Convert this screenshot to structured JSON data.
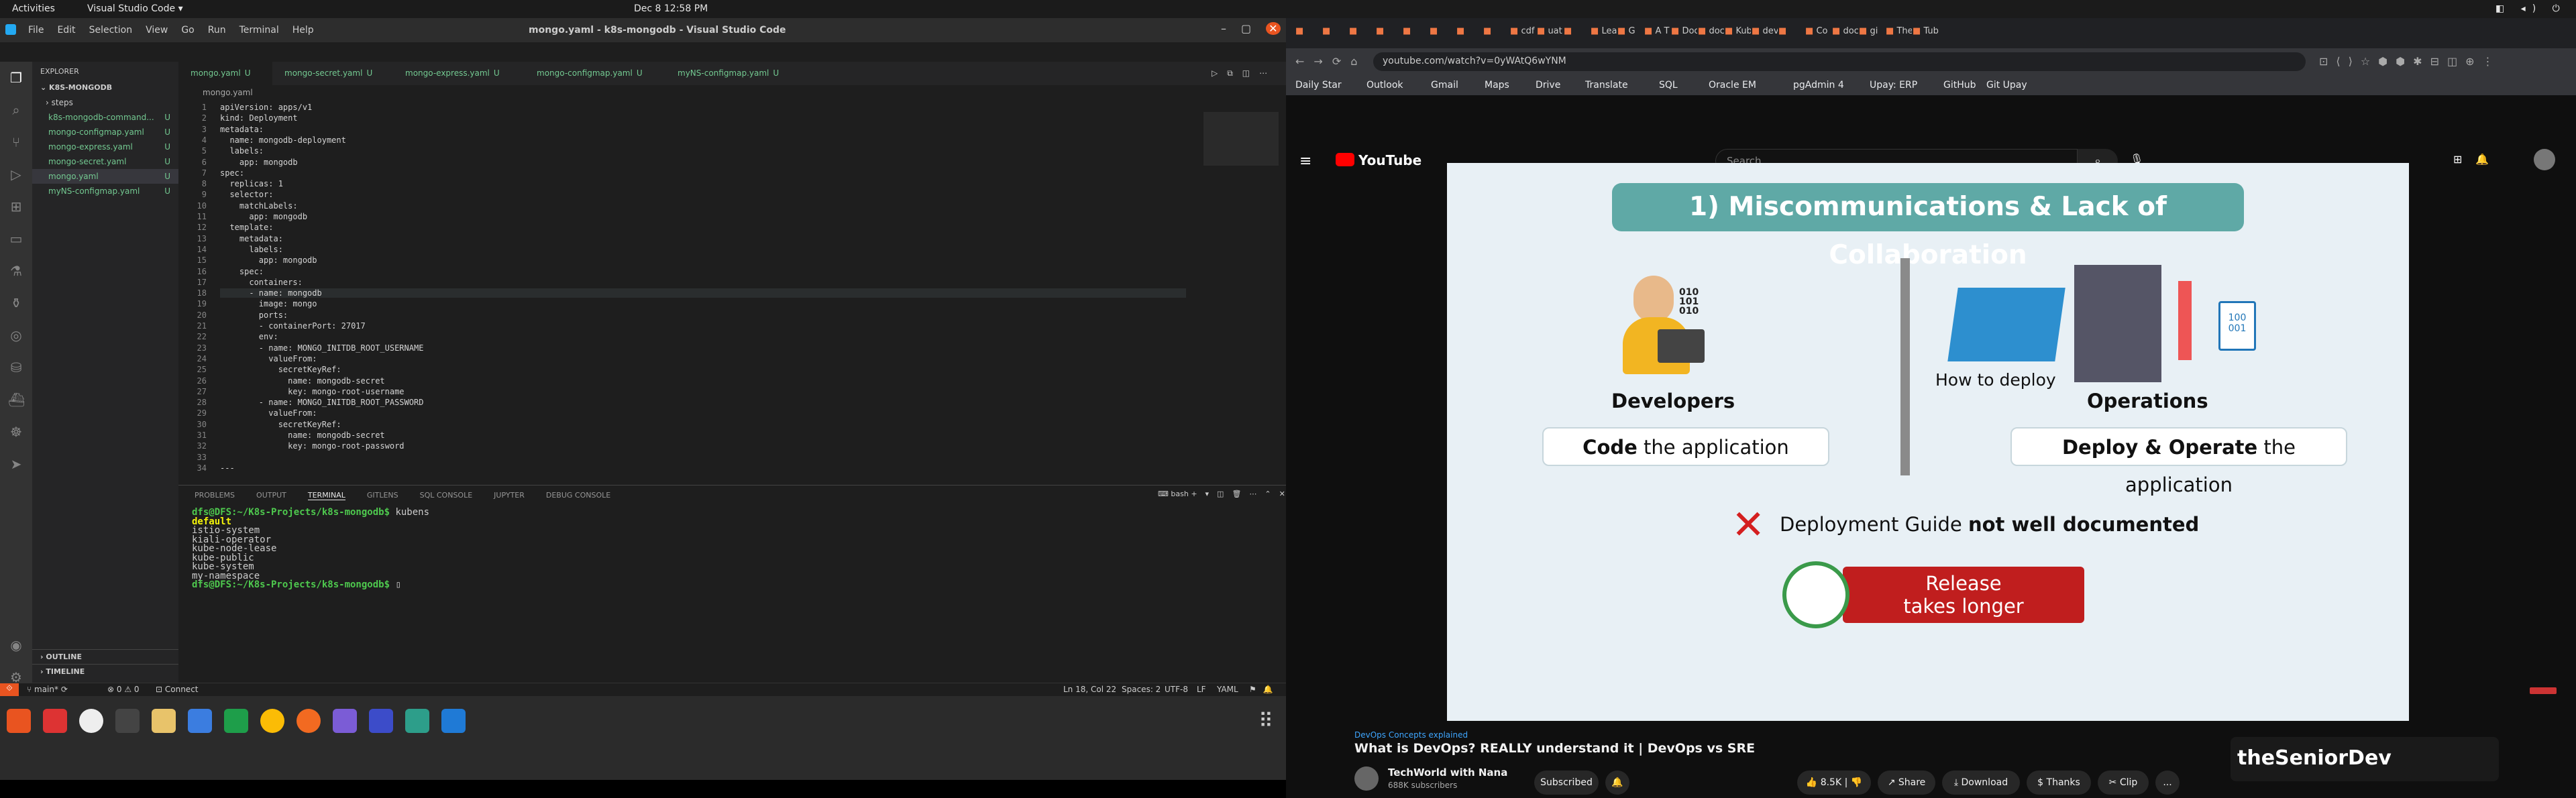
{
  "topbar": {
    "activities": "Activities",
    "app": "Visual Studio Code",
    "datetime": "Dec 8  12:58 PM"
  },
  "vscode": {
    "title": "mongo.yaml - k8s-mongodb - Visual Studio Code",
    "menu": [
      "File",
      "Edit",
      "Selection",
      "View",
      "Go",
      "Run",
      "Terminal",
      "Help"
    ],
    "explorer": {
      "header": "EXPLORER",
      "folder": "K8S-MONGODB",
      "items": [
        {
          "label": "steps",
          "badge": ""
        },
        {
          "label": "k8s-mongodb-command...",
          "badge": "U"
        },
        {
          "label": "mongo-configmap.yaml",
          "badge": "U"
        },
        {
          "label": "mongo-express.yaml",
          "badge": "U"
        },
        {
          "label": "mongo-secret.yaml",
          "badge": "U"
        },
        {
          "label": "mongo.yaml",
          "badge": "U"
        },
        {
          "label": "myNS-configmap.yaml",
          "badge": "U"
        }
      ],
      "outline": "OUTLINE",
      "timeline": "TIMELINE"
    },
    "tabs": [
      {
        "label": "mongo.yaml",
        "badge": "U"
      },
      {
        "label": "mongo-secret.yaml",
        "badge": "U"
      },
      {
        "label": "mongo-express.yaml",
        "badge": "U"
      },
      {
        "label": "mongo-configmap.yaml",
        "badge": "U"
      },
      {
        "label": "myNS-configmap.yaml",
        "badge": "U"
      }
    ],
    "breadcrumb": "mongo.yaml",
    "code": [
      [
        "1",
        "apiVersion: apps/v1"
      ],
      [
        "2",
        "kind: Deployment"
      ],
      [
        "3",
        "metadata:"
      ],
      [
        "4",
        "  name: mongodb-deployment"
      ],
      [
        "5",
        "  labels:"
      ],
      [
        "6",
        "    app: mongodb"
      ],
      [
        "7",
        "spec:"
      ],
      [
        "8",
        "  replicas: 1"
      ],
      [
        "9",
        "  selector:"
      ],
      [
        "10",
        "    matchLabels:"
      ],
      [
        "11",
        "      app: mongodb"
      ],
      [
        "12",
        "  template:"
      ],
      [
        "13",
        "    metadata:"
      ],
      [
        "14",
        "      labels:"
      ],
      [
        "15",
        "        app: mongodb"
      ],
      [
        "16",
        "    spec:"
      ],
      [
        "17",
        "      containers:"
      ],
      [
        "18",
        "      - name: mongodb"
      ],
      [
        "19",
        "        image: mongo"
      ],
      [
        "20",
        "        ports:"
      ],
      [
        "21",
        "        - containerPort: 27017"
      ],
      [
        "22",
        "        env:"
      ],
      [
        "23",
        "        - name: MONGO_INITDB_ROOT_USERNAME"
      ],
      [
        "24",
        "          valueFrom:"
      ],
      [
        "25",
        "            secretKeyRef:"
      ],
      [
        "26",
        "              name: mongodb-secret"
      ],
      [
        "27",
        "              key: mongo-root-username"
      ],
      [
        "28",
        "        - name: MONGO_INITDB_ROOT_PASSWORD"
      ],
      [
        "29",
        "          valueFrom:"
      ],
      [
        "30",
        "            secretKeyRef:"
      ],
      [
        "31",
        "              name: mongodb-secret"
      ],
      [
        "32",
        "              key: mongo-root-password"
      ],
      [
        "33",
        ""
      ],
      [
        "34",
        "---"
      ]
    ],
    "panel_tabs": [
      "PROBLEMS",
      "OUTPUT",
      "TERMINAL",
      "GITLENS",
      "SQL CONSOLE",
      "JUPYTER",
      "DEBUG CONSOLE"
    ],
    "terminal_shell": "bash",
    "terminal": {
      "prompt": "dfs@DFS:~/K8s-Projects/k8s-mongodb$",
      "command": " kubens",
      "output": [
        "default",
        "istio-system",
        "kiali-operator",
        "kube-node-lease",
        "kube-public",
        "kube-system",
        "my-namespace"
      ]
    },
    "status": {
      "branch": "main*",
      "problems": "0 ⚠ 0",
      "connect": "Connect",
      "position": "Ln 18, Col 22",
      "spaces": "Spaces: 2",
      "encoding": "UTF-8",
      "eol": "LF",
      "lang": "YAML"
    }
  },
  "browser": {
    "tabs": [
      "",
      "",
      "",
      "",
      "",
      "",
      "",
      "",
      "cdf",
      "uat",
      "",
      "Lea",
      "G",
      "A T",
      "Doc",
      "doc",
      "Kub",
      "dev",
      "",
      "Co",
      "doc",
      "gi",
      "The",
      "Tub"
    ],
    "url": "youtube.com/watch?v=0yWAtQ6wYNM",
    "bookmarks": [
      "Daily Star",
      "Outlook",
      "Gmail",
      "Maps",
      "Drive",
      "Translate",
      "SQL",
      "Oracle EM",
      "pgAdmin 4",
      "Upay: ERP",
      "GitHub",
      "Git Upay"
    ],
    "search_placeholder": "Search",
    "youtube_logo": "YouTube"
  },
  "video": {
    "title": "1) Miscommunications & Lack of Collaboration",
    "dev_label": "Developers",
    "ops_label": "Operations",
    "how_to": "How to deploy",
    "code_bold": "Code",
    "code_rest": " the application",
    "deploy_bold": "Deploy & Operate",
    "deploy_rest": " the application",
    "guide_pre": "Deployment Guide ",
    "guide_bold": "not well documented",
    "release": [
      "Release",
      "takes longer"
    ],
    "binary": [
      "100",
      "001"
    ]
  },
  "meta": {
    "series": "DevOps Concepts explained",
    "title": "What is DevOps? REALLY understand it | DevOps vs SRE",
    "channel": "TechWorld with Nana",
    "subs": "688K subscribers",
    "subscribe": "Subscribed",
    "likes": "8.5K",
    "share": "Share",
    "download": "Download",
    "thanks": "Thanks",
    "clip": "Clip",
    "more": "...",
    "ad": "theSeniorDev"
  }
}
